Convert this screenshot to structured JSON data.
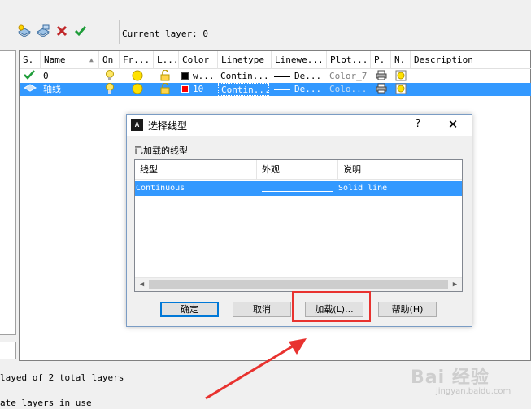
{
  "toolbar": {
    "current_layer_label": "Current layer: 0",
    "buttons": [
      "new-layer-icon",
      "new-layer-vp-frozen-icon",
      "delete-layer-icon",
      "set-current-icon"
    ]
  },
  "layers": {
    "columns": [
      "S.",
      "Name",
      "On",
      "Fr...",
      "L...",
      "Color",
      "Linetype",
      "Linewe...",
      "Plot...",
      "P.",
      "N.",
      "Description"
    ],
    "rows": [
      {
        "status_icon": "check-icon",
        "name": "0",
        "color_name": "w...",
        "color_hex": "#000000",
        "linetype": "Contin...",
        "lineweight": "De...",
        "plot_style": "Color_7"
      },
      {
        "status_icon": "layer-icon",
        "name": "轴线",
        "color_name": "10",
        "color_hex": "#ff0000",
        "linetype": "Contin...",
        "lineweight": "De...",
        "plot_style": "Colo..."
      }
    ]
  },
  "status": {
    "line1": "layed of 2 total layers",
    "line2": "ate layers in use"
  },
  "dialog": {
    "title": "选择线型",
    "help": "?",
    "close": "✕",
    "section_label": "已加载的线型",
    "columns": [
      "线型",
      "外观",
      "说明"
    ],
    "rows": [
      {
        "linetype": "Continuous",
        "description": "Solid line"
      }
    ],
    "buttons": {
      "ok": "确定",
      "cancel": "取消",
      "load": "加载(L)...",
      "help": "帮助(H)"
    }
  },
  "annotation": {
    "highlight_color": "#e8322f"
  },
  "watermark": {
    "main": "Bai 经验",
    "sub": "jingyan.baidu.com"
  },
  "colors": {
    "selection": "#3399ff",
    "accent": "#0078d7"
  }
}
